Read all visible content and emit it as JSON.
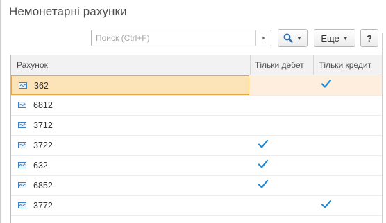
{
  "page": {
    "title": "Немонетарні рахунки"
  },
  "search": {
    "placeholder": "Поиск (Ctrl+F)",
    "value": "",
    "clear_label": "×"
  },
  "toolbar": {
    "more_label": "Еще",
    "help_label": "?"
  },
  "colors": {
    "check": "#1f8ad6",
    "selected_row": "#fdeedd",
    "selected_cell_border": "#e6a64a",
    "account_icon": "#3b7fc4"
  },
  "icons": {
    "search": "magnifier-icon",
    "account": "account-icon",
    "check": "checkmark-icon"
  },
  "table": {
    "columns": {
      "account": "Рахунок",
      "debit_only": "Тільки дебет",
      "credit_only": "Тільки кредит"
    },
    "rows": [
      {
        "account": "362",
        "debit_only": false,
        "credit_only": true,
        "selected": true
      },
      {
        "account": "6812",
        "debit_only": false,
        "credit_only": false,
        "selected": false
      },
      {
        "account": "3712",
        "debit_only": false,
        "credit_only": false,
        "selected": false
      },
      {
        "account": "3722",
        "debit_only": true,
        "credit_only": false,
        "selected": false
      },
      {
        "account": "632",
        "debit_only": true,
        "credit_only": false,
        "selected": false
      },
      {
        "account": "6852",
        "debit_only": true,
        "credit_only": false,
        "selected": false
      },
      {
        "account": "3772",
        "debit_only": false,
        "credit_only": true,
        "selected": false
      }
    ]
  }
}
